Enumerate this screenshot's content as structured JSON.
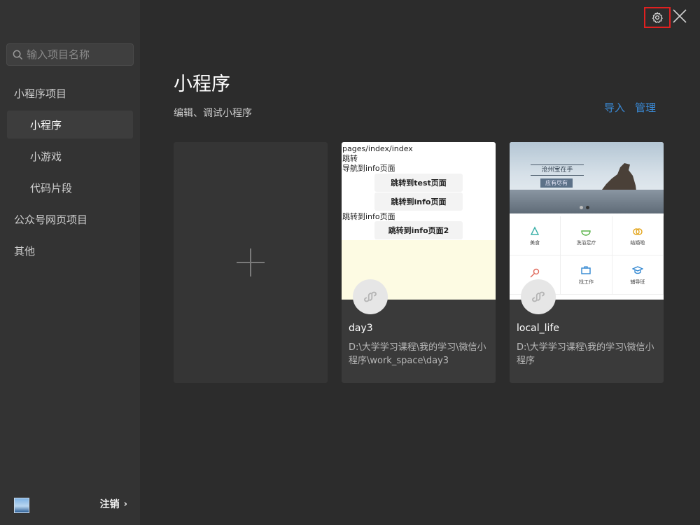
{
  "sidebar": {
    "search_placeholder": "输入项目名称",
    "items": [
      {
        "label": "小程序项目"
      },
      {
        "label": "小程序"
      },
      {
        "label": "小游戏"
      },
      {
        "label": "代码片段"
      },
      {
        "label": "公众号网页项目"
      },
      {
        "label": "其他"
      }
    ],
    "logout_label": "注销",
    "logout_chevron": "›"
  },
  "header": {
    "title": "小程序",
    "subtitle": "编辑、调试小程序",
    "import_label": "导入",
    "manage_label": "管理"
  },
  "projects": [
    {
      "name": "day3",
      "path": "D:\\大学学习课程\\我的学习\\微信小程序\\work_space\\day3",
      "thumbnail": {
        "line1": "pages/index/index",
        "line2": "跳转",
        "line3": "导航到info页面",
        "btn1": "跳转到test页面",
        "btn2": "跳转到info页面",
        "line4": "跳转到info页面",
        "btn3": "跳转到info页面2"
      }
    },
    {
      "name": "local_life",
      "path": "D:\\大学学习课程\\我的学习\\微信小程序",
      "thumbnail": {
        "banner_text": "沧州宝在手",
        "banner_sub": "应有尽有",
        "grid": [
          "美食",
          "洗浴足疗",
          "结婚啦",
          "",
          "找工作",
          "辅导班"
        ]
      }
    }
  ],
  "colors": {
    "accent": "#3a8bd8",
    "highlight_border": "#e02020"
  },
  "icons": {
    "settings": "gear-icon",
    "close": "close-icon",
    "search": "search-icon",
    "project": "link-icon"
  }
}
